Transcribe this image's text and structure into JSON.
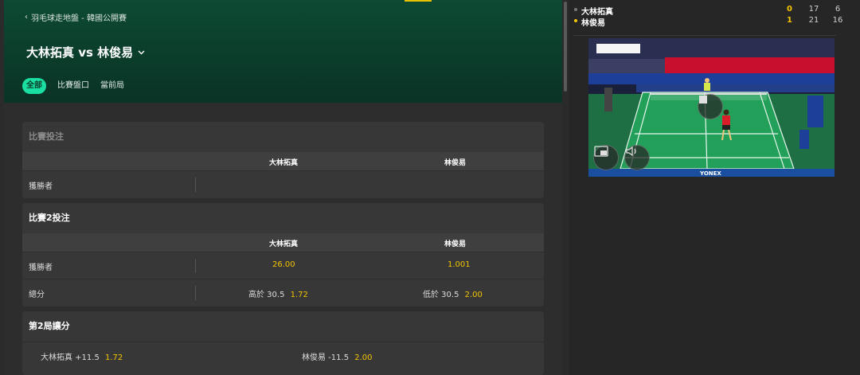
{
  "header": {
    "breadcrumb": "羽毛球走地盤 - 韓國公開賽",
    "title": "大林拓真 vs 林俊易",
    "tabs": [
      {
        "label": "全部",
        "active": true
      },
      {
        "label": "比賽盤口",
        "active": false
      },
      {
        "label": "當前局",
        "active": false
      }
    ]
  },
  "markets": [
    {
      "title": "比賽投注",
      "suspended": true,
      "col1": "大林拓真",
      "col2": "林俊易",
      "rows": [
        {
          "label": "獲勝者"
        }
      ]
    },
    {
      "title": "比賽2投注",
      "suspended": false,
      "col1": "大林拓真",
      "col2": "林俊易",
      "rows": [
        {
          "label": "獲勝者",
          "left_odds": "26.00",
          "right_odds": "1.001"
        },
        {
          "label": "總分",
          "left_prefix": "高於 30.5",
          "left_odds": "1.72",
          "right_prefix": "低於 30.5",
          "right_odds": "2.00"
        }
      ]
    },
    {
      "title": "第2局讓分",
      "row": {
        "left_prefix": "大林拓真 +11.5",
        "left_odds": "1.72",
        "right_prefix": "林俊易 -11.5",
        "right_odds": "2.00"
      }
    }
  ],
  "scoreboard": {
    "players": [
      {
        "name": "大林拓真",
        "games": "0",
        "set1": "17",
        "set2": "6",
        "serving": false
      },
      {
        "name": "林俊易",
        "games": "1",
        "set1": "21",
        "set2": "16",
        "serving": true
      }
    ]
  },
  "video": {
    "ad_board_text": "YONEX",
    "controls": [
      "stop-icon",
      "picture-in-picture-icon",
      "volume-icon"
    ]
  },
  "colors": {
    "header_green": "#0b3d2b",
    "active_tab": "#19e0a2",
    "odds_yellow": "#f3c400",
    "court_green": "#1e8a4a"
  }
}
